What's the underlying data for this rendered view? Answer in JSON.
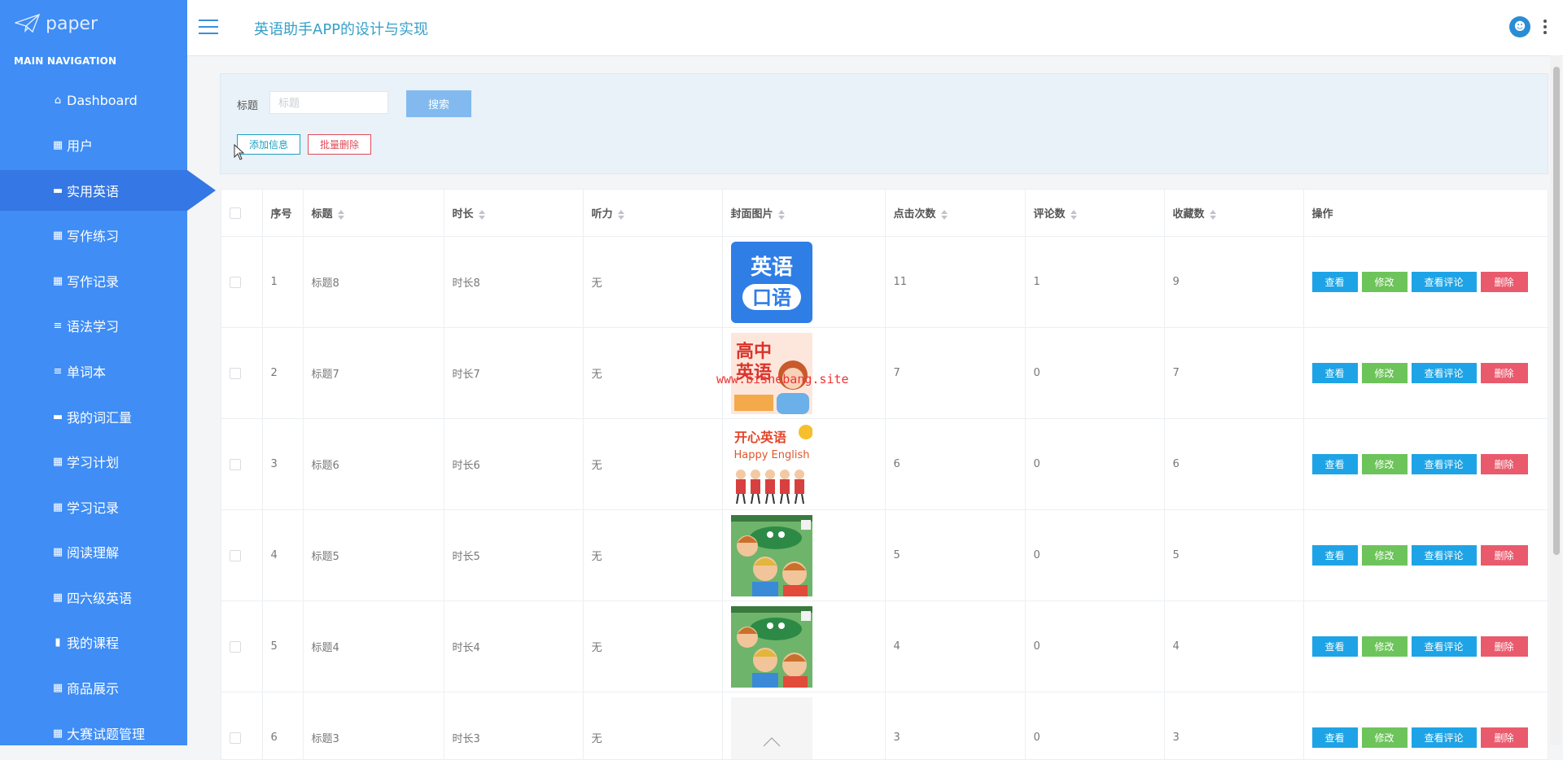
{
  "logo": {
    "text": "paper"
  },
  "sidebar": {
    "heading": "MAIN NAVIGATION",
    "items": [
      {
        "label": "Dashboard",
        "icon": "⌂"
      },
      {
        "label": "用户",
        "icon": "▦"
      },
      {
        "label": "实用英语",
        "icon": "▬"
      },
      {
        "label": "写作练习",
        "icon": "▦"
      },
      {
        "label": "写作记录",
        "icon": "▦"
      },
      {
        "label": "语法学习",
        "icon": "≡"
      },
      {
        "label": "单词本",
        "icon": "≡"
      },
      {
        "label": "我的词汇量",
        "icon": "▬"
      },
      {
        "label": "学习计划",
        "icon": "▦"
      },
      {
        "label": "学习记录",
        "icon": "▦"
      },
      {
        "label": "阅读理解",
        "icon": "▦"
      },
      {
        "label": "四六级英语",
        "icon": "▦"
      },
      {
        "label": "我的课程",
        "icon": "▮"
      },
      {
        "label": "商品展示",
        "icon": "▦"
      },
      {
        "label": "大赛试题管理",
        "icon": "▦"
      }
    ],
    "active_index": 2
  },
  "header": {
    "title": "英语助手APP的设计与实现"
  },
  "search": {
    "label": "标题",
    "placeholder": "标题",
    "value": "",
    "button": "搜索"
  },
  "toolbar": {
    "add": "添加信息",
    "batch_delete": "批量删除"
  },
  "table": {
    "columns": [
      "序号",
      "标题",
      "时长",
      "听力",
      "封面图片",
      "点击次数",
      "评论数",
      "收藏数",
      "操作"
    ],
    "actions": {
      "view": "查看",
      "edit": "修改",
      "comments": "查看评论",
      "delete": "删除"
    },
    "rows": [
      {
        "index": "1",
        "title": "标题8",
        "duration": "时长8",
        "listening": "无",
        "cover": "cover-oral-english",
        "clicks": "11",
        "comments": "1",
        "favorites": "9"
      },
      {
        "index": "2",
        "title": "标题7",
        "duration": "时长7",
        "listening": "无",
        "cover": "cover-high-school-english",
        "clicks": "7",
        "comments": "0",
        "favorites": "7"
      },
      {
        "index": "3",
        "title": "标题6",
        "duration": "时长6",
        "listening": "无",
        "cover": "cover-happy-english",
        "clicks": "6",
        "comments": "0",
        "favorites": "6"
      },
      {
        "index": "4",
        "title": "标题5",
        "duration": "时长5",
        "listening": "无",
        "cover": "cover-cartoon-kids",
        "clicks": "5",
        "comments": "0",
        "favorites": "5"
      },
      {
        "index": "5",
        "title": "标题4",
        "duration": "时长4",
        "listening": "无",
        "cover": "cover-cartoon-kids",
        "clicks": "4",
        "comments": "0",
        "favorites": "4"
      },
      {
        "index": "6",
        "title": "标题3",
        "duration": "时长3",
        "listening": "无",
        "cover": "cover-blank",
        "clicks": "3",
        "comments": "0",
        "favorites": "3"
      }
    ]
  },
  "cover_text": {
    "oral_line1": "英语",
    "oral_line2": "口语",
    "hs_line1": "高中",
    "hs_line2": "英语",
    "happy_cn": "开心英语",
    "happy_en": "Happy English"
  },
  "watermark": "www.bishebang.site",
  "colors": {
    "sidebar": "#3f8df5",
    "sidebar_active": "#3577e4",
    "accent": "#37a0c9",
    "view": "#1ea4e6",
    "edit": "#6dc45a",
    "delete": "#ea5a6d"
  }
}
